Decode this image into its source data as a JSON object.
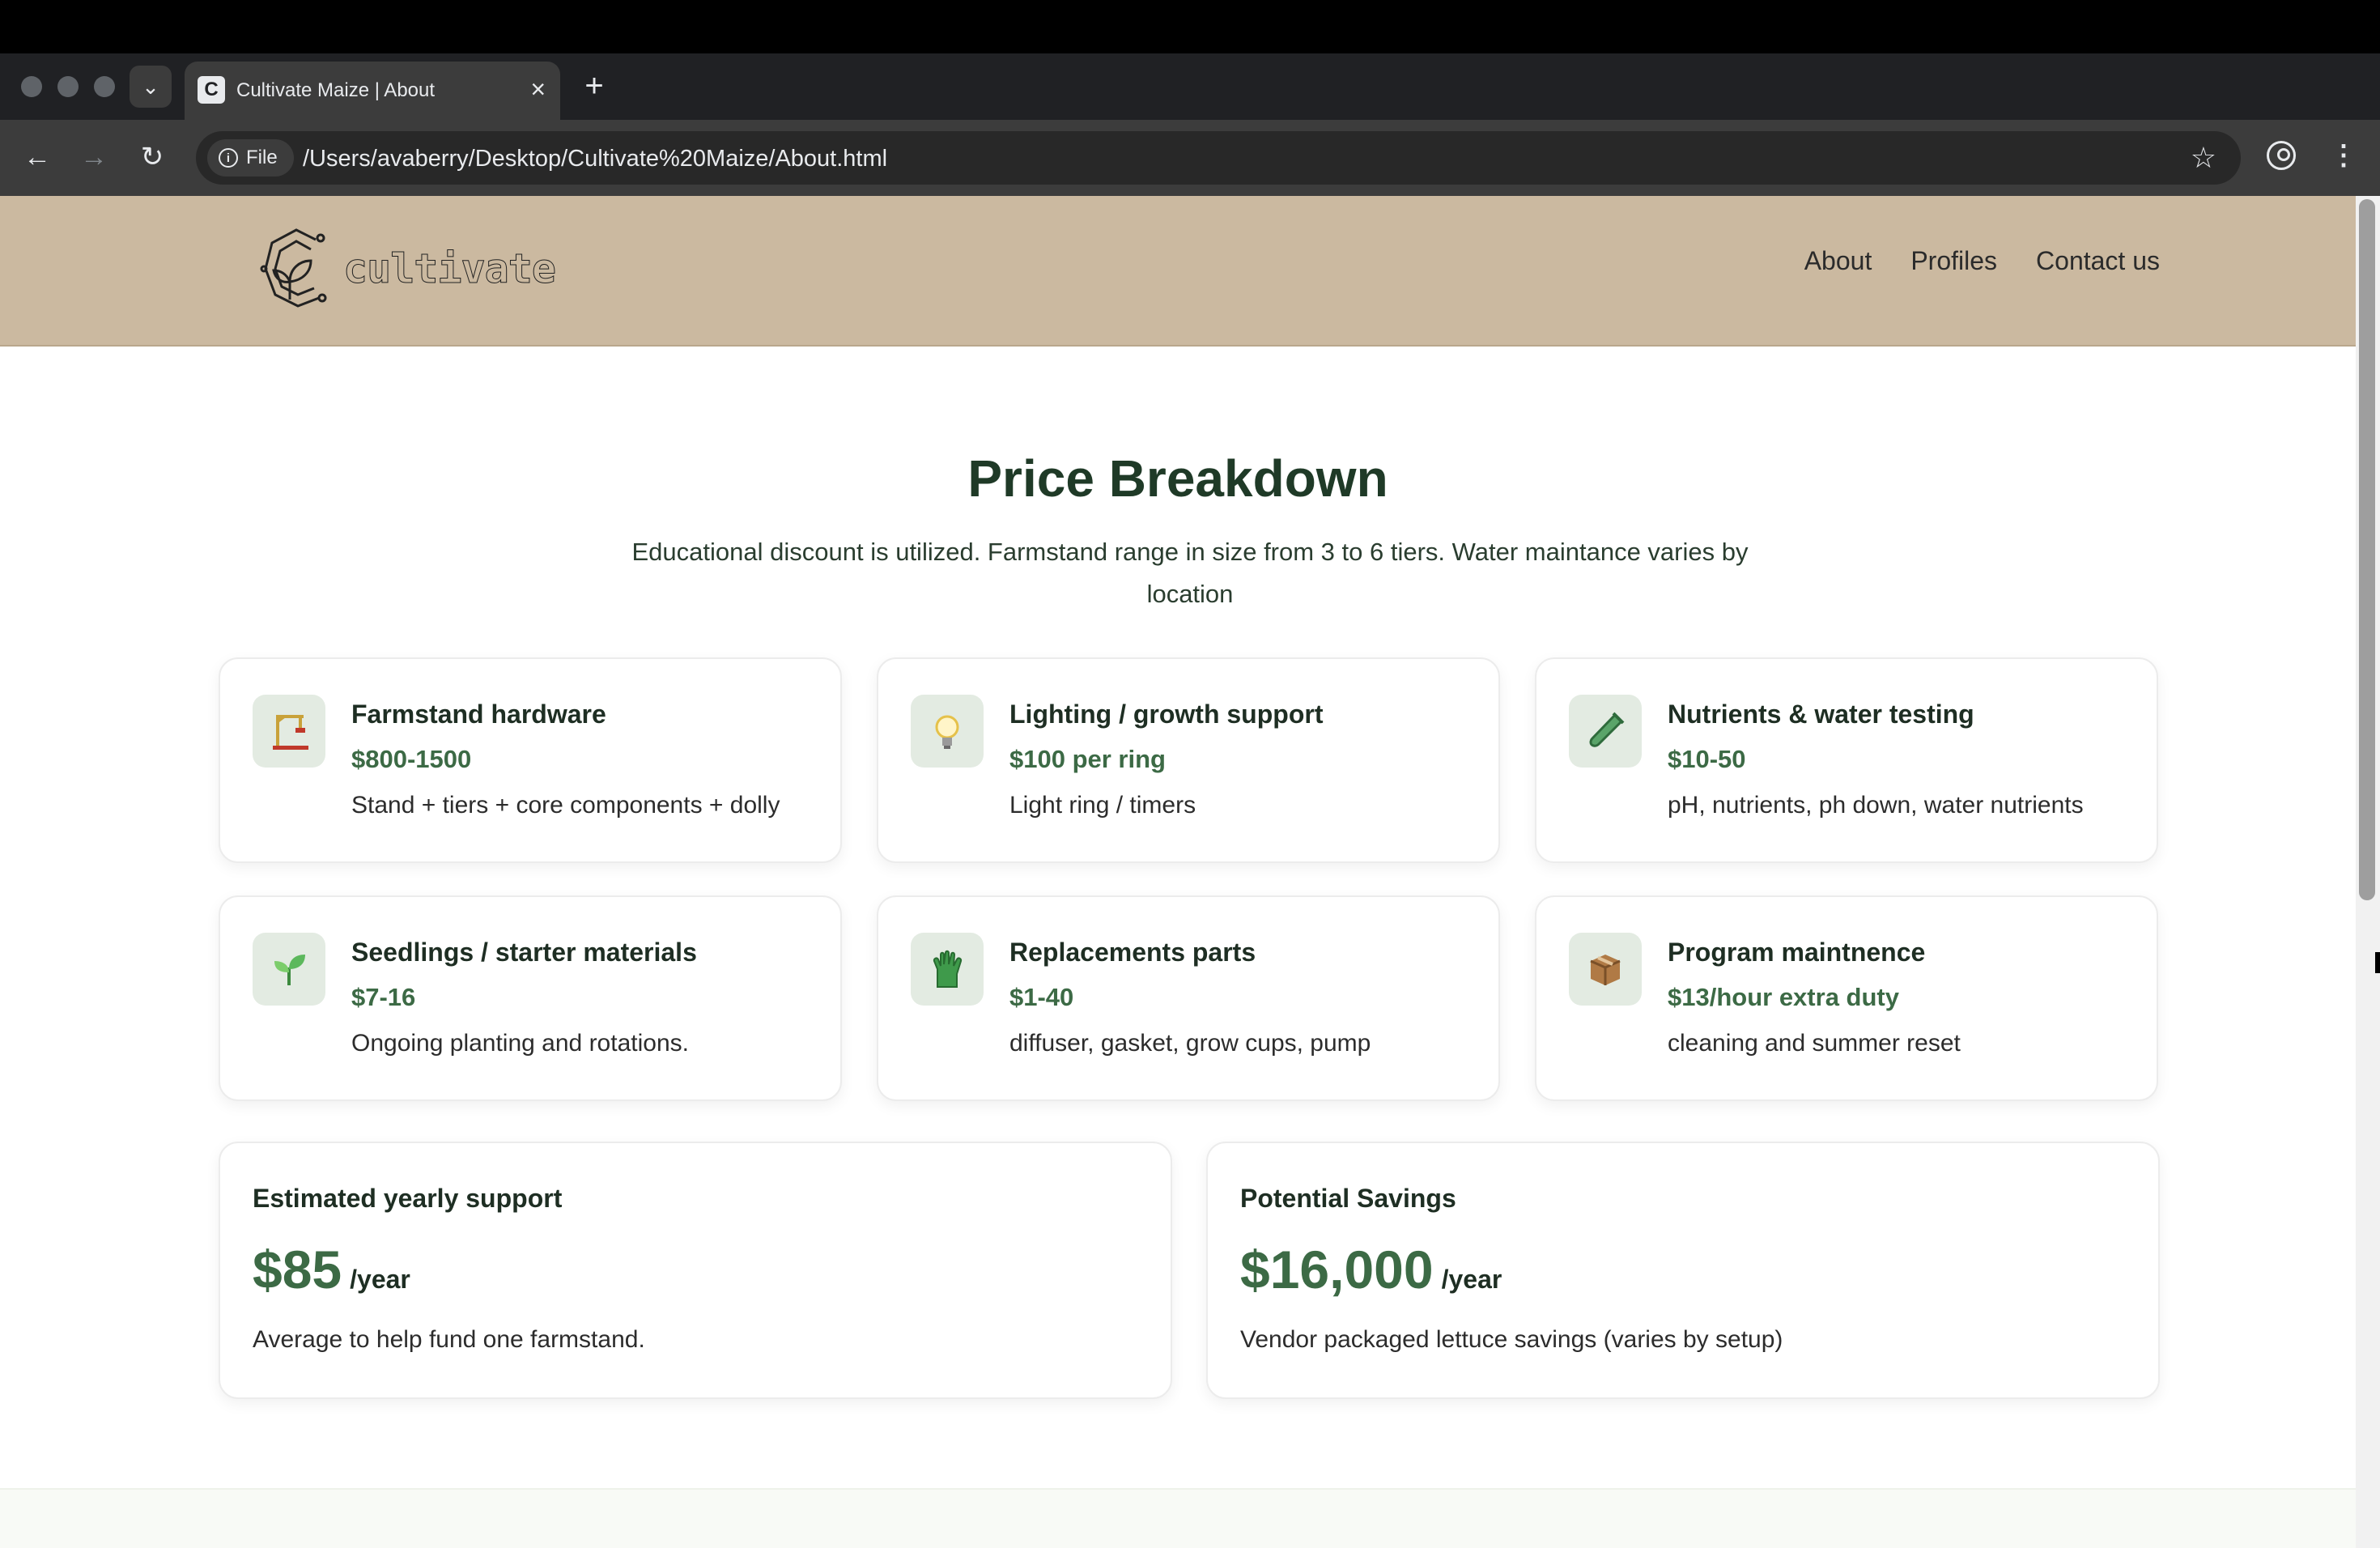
{
  "browser": {
    "tab_title": "Cultivate Maize | About",
    "close_glyph": "×",
    "new_tab_glyph": "+",
    "site_chip_label": "File",
    "url": "/Users/avaberry/Desktop/Cultivate%20Maize/About.html",
    "back_glyph": "←",
    "forward_glyph": "→",
    "reload_glyph": "↻",
    "star_glyph": "☆",
    "menu_glyph": "⋮",
    "tab_list_glyph": "⌄"
  },
  "site": {
    "logo_text": "cultivate",
    "nav": [
      {
        "label": "About"
      },
      {
        "label": "Profiles"
      },
      {
        "label": "Contact us"
      }
    ],
    "header_color": "#cbb9a0",
    "accent_color": "#3c6a45"
  },
  "page": {
    "title": "Price Breakdown",
    "intro": "Educational discount is utilized. Farmstand range in size from 3 to 6 tiers. Water maintance varies by location"
  },
  "costs": [
    {
      "icon": "crane-icon",
      "name": "Farmstand hardware",
      "price": "$800-1500",
      "desc": "Stand + tiers + core components + dolly"
    },
    {
      "icon": "light-bulb-icon",
      "name": "Lighting / growth support",
      "price": "$100 per ring",
      "desc": "Light ring / timers"
    },
    {
      "icon": "test-tube-icon",
      "name": "Nutrients & water testing",
      "price": "$10-50",
      "desc": "pH, nutrients, ph down, water nutrients"
    },
    {
      "icon": "seedling-icon",
      "name": "Seedlings / starter materials",
      "price": "$7-16",
      "desc": "Ongoing planting and rotations."
    },
    {
      "icon": "glove-icon",
      "name": "Replacements parts",
      "price": "$1-40",
      "desc": "diffuser, gasket, grow cups, pump"
    },
    {
      "icon": "package-icon",
      "name": "Program maintnence",
      "price": "$13/hour extra duty",
      "desc": "cleaning and summer reset"
    }
  ],
  "summary": [
    {
      "label": "Estimated yearly support",
      "value": "$85",
      "unit": "/year",
      "desc": "Average to help fund one farmstand."
    },
    {
      "label": "Potential Savings",
      "value": "$16,000",
      "unit": "/year",
      "desc": "Vendor packaged lettuce savings (varies by setup)"
    }
  ]
}
